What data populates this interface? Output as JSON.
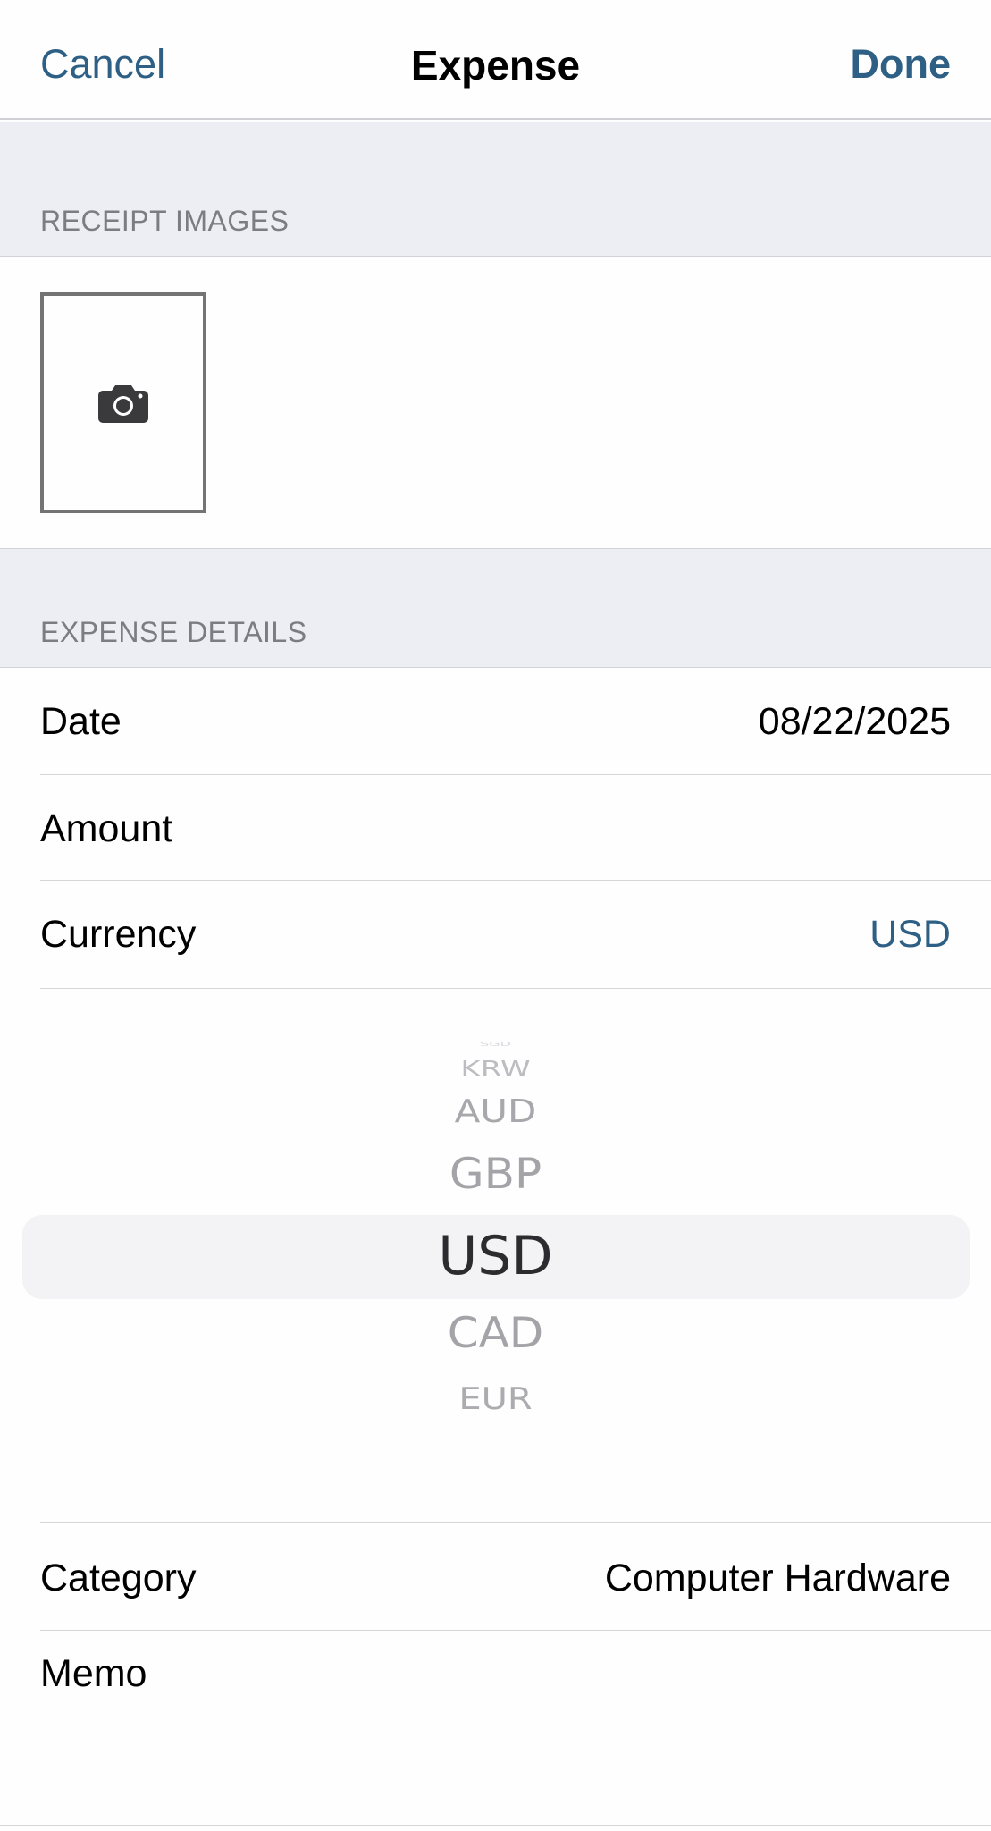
{
  "nav": {
    "cancel_label": "Cancel",
    "title": "Expense",
    "done_label": "Done"
  },
  "sections": {
    "receipt_images": "RECEIPT IMAGES",
    "expense_details": "EXPENSE DETAILS"
  },
  "receipt": {
    "add_photo_icon": "camera-icon"
  },
  "fields": {
    "date": {
      "label": "Date",
      "value": "08/22/2025"
    },
    "amount": {
      "label": "Amount",
      "value": ""
    },
    "currency": {
      "label": "Currency",
      "value": "USD"
    },
    "category": {
      "label": "Category",
      "value": "Computer Hardware"
    },
    "memo": {
      "label": "Memo",
      "value": ""
    }
  },
  "currency_picker": {
    "options": [
      "SGD",
      "KRW",
      "AUD",
      "GBP",
      "USD",
      "CAD",
      "EUR"
    ],
    "selected": "USD"
  },
  "colors": {
    "accent": "#2e5f84",
    "section_bg": "#ededf4",
    "secondary_text": "#7c7c82"
  }
}
